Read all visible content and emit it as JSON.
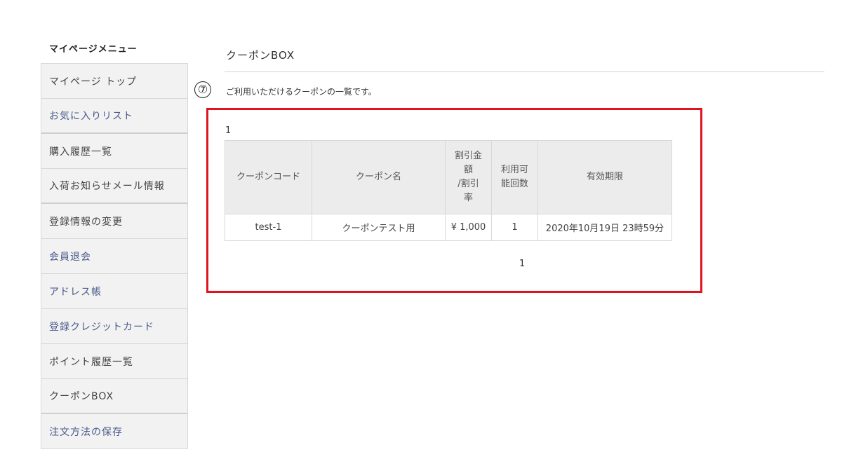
{
  "sidebar": {
    "heading": "マイページメニュー",
    "items": [
      {
        "label": "マイページ トップ",
        "style": "plain"
      },
      {
        "label": "お気に入りリスト",
        "style": "link"
      },
      {
        "label": "購入履歴一覧",
        "style": "plain"
      },
      {
        "label": "入荷お知らせメール情報",
        "style": "plain"
      },
      {
        "label": "登録情報の変更",
        "style": "plain"
      },
      {
        "label": "会員退会",
        "style": "link"
      },
      {
        "label": "アドレス帳",
        "style": "link"
      },
      {
        "label": "登録クレジットカード",
        "style": "link"
      },
      {
        "label": "ポイント履歴一覧",
        "style": "plain"
      },
      {
        "label": "クーポンBOX",
        "style": "plain"
      },
      {
        "label": "注文方法の保存",
        "style": "link"
      }
    ]
  },
  "main": {
    "title": "クーポンBOX",
    "step_marker": "⑦",
    "description": "ご利用いただけるクーポンの一覧です。",
    "count_label": "1",
    "table": {
      "headers": [
        "クーポンコード",
        "クーポン名",
        "割引金\n額\n/割引\n率",
        "利用可\n能回数",
        "有効期限"
      ],
      "rows": [
        [
          "test-1",
          "クーポンテスト用",
          "¥ 1,000",
          "1",
          "2020年10月19日 23時59分"
        ]
      ]
    },
    "pager": "1"
  },
  "colors": {
    "highlight": "#e0141e",
    "link_text": "#4a5a8c",
    "sidebar_bg": "#f2f2f2",
    "header_bg": "#ececec"
  }
}
